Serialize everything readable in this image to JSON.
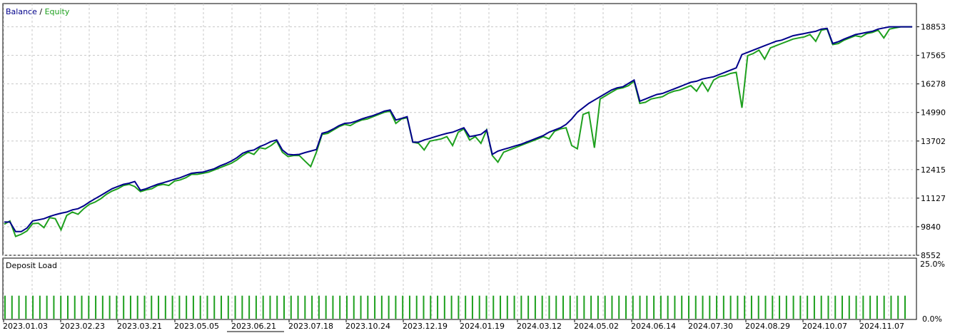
{
  "legend": {
    "balance_label": "Balance",
    "separator": " / ",
    "equity_label": "Equity",
    "balance_color": "#00008b",
    "equity_color": "#1ea01e"
  },
  "chart_data": [
    {
      "type": "line",
      "title": "",
      "ylim": [
        8552,
        19900
      ],
      "y_tick_labels": [
        "18853",
        "17565",
        "16278",
        "14990",
        "13702",
        "12415",
        "11127",
        "9840",
        "8552"
      ],
      "y_ticks": [
        18853,
        17565,
        16278,
        14990,
        13702,
        12415,
        11127,
        9840,
        8552
      ],
      "x_tick_labels": [
        "2023.01.03",
        "2023.02.23",
        "2023.03.21",
        "2023.05.05",
        "2023.06.21",
        "2023.07.18",
        "2023.10.24",
        "2023.12.19",
        "2024.01.19",
        "2024.03.12",
        "2024.05.02",
        "2024.06.14",
        "2024.07.30",
        "2024.08.29",
        "2024.10.07",
        "2024.11.07"
      ],
      "grid": true,
      "legend_position": "top-left",
      "series": [
        {
          "name": "Balance",
          "color": "#00008b",
          "x": [
            0,
            1,
            2,
            3,
            4,
            5,
            6,
            7,
            8,
            9,
            10,
            11,
            12,
            13,
            14,
            15,
            16,
            17,
            18,
            19,
            20,
            21,
            22,
            23,
            24,
            25,
            26,
            27,
            28,
            29,
            30,
            31,
            32,
            33,
            34,
            35,
            36,
            37,
            38,
            39,
            40,
            41,
            42,
            43,
            44,
            45,
            46,
            47,
            48,
            49,
            50,
            51,
            52,
            53,
            54,
            55,
            56,
            57,
            58,
            59,
            60,
            61,
            62,
            63,
            64,
            65,
            66,
            67,
            68,
            69,
            70,
            71,
            72,
            73,
            74,
            75,
            76,
            77,
            78,
            79,
            80,
            81,
            82,
            83,
            84,
            85,
            86,
            87,
            88,
            89,
            90,
            91,
            92,
            93,
            94,
            95,
            96,
            97,
            98,
            99,
            100,
            101,
            102,
            103,
            104,
            105,
            106,
            107,
            108,
            109,
            110,
            111,
            112,
            113,
            114,
            115,
            116,
            117,
            118,
            119,
            120,
            121,
            122,
            123,
            124,
            125,
            126,
            127,
            128,
            129,
            130,
            131,
            132,
            133,
            134,
            135,
            136,
            137,
            138,
            139,
            140,
            141,
            142,
            143,
            144,
            145,
            146,
            147,
            148,
            149,
            150,
            151,
            152,
            153,
            154,
            155,
            156,
            157,
            158,
            159,
            160
          ],
          "values": [
            10050,
            10050,
            9620,
            9620,
            9780,
            10100,
            10150,
            10200,
            10300,
            10380,
            10450,
            10500,
            10600,
            10650,
            10780,
            10950,
            11100,
            11250,
            11400,
            11550,
            11650,
            11750,
            11800,
            11880,
            11480,
            11550,
            11650,
            11750,
            11820,
            11900,
            11980,
            12050,
            12150,
            12250,
            12280,
            12300,
            12380,
            12450,
            12580,
            12680,
            12800,
            12950,
            13150,
            13250,
            13300,
            13450,
            13550,
            13680,
            13750,
            13300,
            13100,
            13080,
            13100,
            13180,
            13250,
            13320,
            14050,
            14120,
            14250,
            14400,
            14500,
            14520,
            14600,
            14700,
            14780,
            14850,
            14950,
            15050,
            15100,
            14650,
            14720,
            14800,
            13650,
            13650,
            13750,
            13820,
            13900,
            13980,
            14050,
            14100,
            14200,
            14300,
            13900,
            13950,
            14000,
            14200,
            13100,
            13250,
            13330,
            13400,
            13480,
            13550,
            13650,
            13750,
            13850,
            13950,
            14100,
            14200,
            14300,
            14450,
            14700,
            15000,
            15200,
            15400,
            15550,
            15700,
            15850,
            16000,
            16100,
            16150,
            16300,
            16450,
            15500,
            15600,
            15700,
            15800,
            15850,
            15950,
            16050,
            16150,
            16250,
            16350,
            16400,
            16500,
            16550,
            16600,
            16700,
            16800,
            16900,
            17000,
            17600,
            17700,
            17800,
            17900,
            18000,
            18100,
            18200,
            18250,
            18350,
            18450,
            18500,
            18550,
            18600,
            18650,
            18750,
            18780,
            18100,
            18180,
            18300,
            18400,
            18500,
            18550,
            18600,
            18650,
            18750,
            18800,
            18853,
            18853,
            18853,
            18853,
            18853
          ],
          "note_x": "x values are trade sequence indices"
        },
        {
          "name": "Equity",
          "color": "#1ea01e",
          "x": [
            0,
            1,
            2,
            3,
            4,
            5,
            6,
            7,
            8,
            9,
            10,
            11,
            12,
            13,
            14,
            15,
            16,
            17,
            18,
            19,
            20,
            21,
            22,
            23,
            24,
            25,
            26,
            27,
            28,
            29,
            30,
            31,
            32,
            33,
            34,
            35,
            36,
            37,
            38,
            39,
            40,
            41,
            42,
            43,
            44,
            45,
            46,
            47,
            48,
            49,
            50,
            51,
            52,
            53,
            54,
            55,
            56,
            57,
            58,
            59,
            60,
            61,
            62,
            63,
            64,
            65,
            66,
            67,
            68,
            69,
            70,
            71,
            72,
            73,
            74,
            75,
            76,
            77,
            78,
            79,
            80,
            81,
            82,
            83,
            84,
            85,
            86,
            87,
            88,
            89,
            90,
            91,
            92,
            93,
            94,
            95,
            96,
            97,
            98,
            99,
            100,
            101,
            102,
            103,
            104,
            105,
            106,
            107,
            108,
            109,
            110,
            111,
            112,
            113,
            114,
            115,
            116,
            117,
            118,
            119,
            120,
            121,
            122,
            123,
            124,
            125,
            126,
            127,
            128,
            129,
            130,
            131,
            132,
            133,
            134,
            135,
            136,
            137,
            138,
            139,
            140,
            141,
            142,
            143,
            144,
            145,
            146,
            147,
            148,
            149,
            150,
            151,
            152,
            153,
            154,
            155,
            156,
            157,
            158,
            159,
            160
          ],
          "values": [
            9950,
            10100,
            9400,
            9500,
            9650,
            9980,
            10000,
            9800,
            10250,
            10200,
            9700,
            10350,
            10500,
            10400,
            10650,
            10850,
            10950,
            11100,
            11300,
            11450,
            11550,
            11700,
            11750,
            11650,
            11420,
            11500,
            11550,
            11700,
            11750,
            11700,
            11900,
            11950,
            12050,
            12200,
            12200,
            12250,
            12300,
            12400,
            12500,
            12600,
            12700,
            12850,
            13050,
            13200,
            13100,
            13400,
            13350,
            13500,
            13700,
            13200,
            13000,
            13050,
            13050,
            12800,
            12550,
            13200,
            14000,
            14050,
            14200,
            14350,
            14450,
            14400,
            14550,
            14650,
            14700,
            14800,
            14900,
            15000,
            15050,
            14500,
            14700,
            14750,
            13650,
            13600,
            13300,
            13700,
            13750,
            13800,
            13900,
            13500,
            14100,
            14250,
            13750,
            13900,
            13600,
            14200,
            13050,
            12750,
            13200,
            13300,
            13400,
            13500,
            13600,
            13700,
            13800,
            13900,
            13800,
            14150,
            14250,
            14300,
            13500,
            13350,
            14900,
            15000,
            13400,
            15600,
            15750,
            15900,
            16050,
            16100,
            16200,
            16400,
            15400,
            15450,
            15600,
            15650,
            15700,
            15850,
            15950,
            16000,
            16100,
            16200,
            15950,
            16350,
            15950,
            16450,
            16600,
            16650,
            16750,
            16800,
            15200,
            17550,
            17650,
            17800,
            17400,
            17900,
            18000,
            18100,
            18200,
            18300,
            18350,
            18400,
            18500,
            18200,
            18700,
            18750,
            18050,
            18100,
            18250,
            18350,
            18450,
            18400,
            18550,
            18600,
            18700,
            18350,
            18750,
            18800,
            18853,
            18853,
            18853
          ],
          "note_x": "x values are trade sequence indices"
        }
      ]
    },
    {
      "type": "bar",
      "title": "Deposit Load",
      "ylim": [
        0,
        25
      ],
      "y_tick_labels": [
        "25.0%",
        "0.0%"
      ],
      "y_ticks": [
        25,
        0
      ],
      "bar_color": "#1ea01e",
      "bar_count": 130,
      "values_pct_constant": 10.5
    }
  ]
}
